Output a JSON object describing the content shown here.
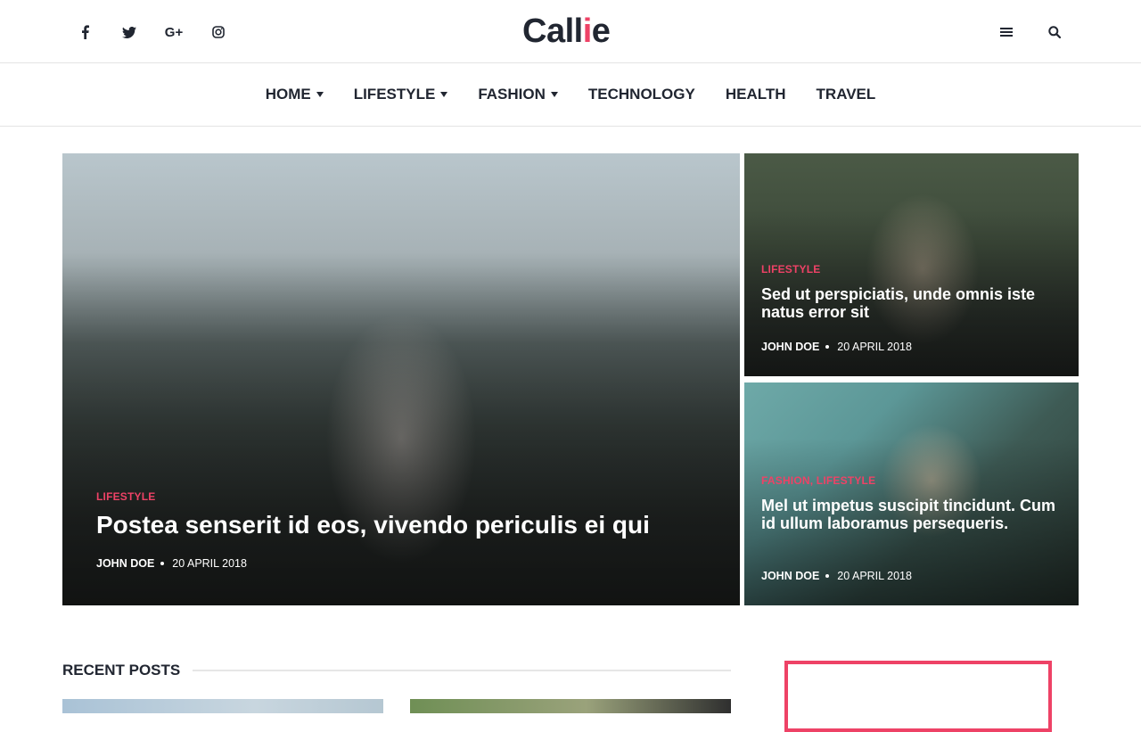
{
  "colors": {
    "accent": "#ee4266",
    "text": "#212631",
    "border": "#e4e4e4"
  },
  "header": {
    "logo_main": "Call",
    "logo_accent": "i",
    "logo_end": "e",
    "social": [
      {
        "icon": "facebook-icon"
      },
      {
        "icon": "twitter-icon"
      },
      {
        "icon": "google-plus-icon",
        "label": "G+"
      },
      {
        "icon": "instagram-icon"
      }
    ],
    "tools": [
      {
        "icon": "menu-icon"
      },
      {
        "icon": "search-icon"
      }
    ]
  },
  "nav": {
    "items": [
      {
        "label": "HOME",
        "dropdown": true
      },
      {
        "label": "LIFESTYLE",
        "dropdown": true
      },
      {
        "label": "FASHION",
        "dropdown": true
      },
      {
        "label": "TECHNOLOGY",
        "dropdown": false
      },
      {
        "label": "HEALTH",
        "dropdown": false
      },
      {
        "label": "TRAVEL",
        "dropdown": false
      }
    ]
  },
  "featured": [
    {
      "category": "LIFESTYLE",
      "title": "Postea senserit id eos, vivendo periculis ei qui",
      "author": "JOHN DOE",
      "date": "20 APRIL 2018"
    },
    {
      "category": "LIFESTYLE",
      "title": "Sed ut perspiciatis, unde omnis iste natus error sit",
      "author": "JOHN DOE",
      "date": "20 APRIL 2018"
    },
    {
      "category": "FASHION, LIFESTYLE",
      "title": "Mel ut impetus suscipit tincidunt. Cum id ullum laboramus persequeris.",
      "author": "JOHN DOE",
      "date": "20 APRIL 2018"
    }
  ],
  "recent": {
    "heading": "RECENT POSTS"
  }
}
